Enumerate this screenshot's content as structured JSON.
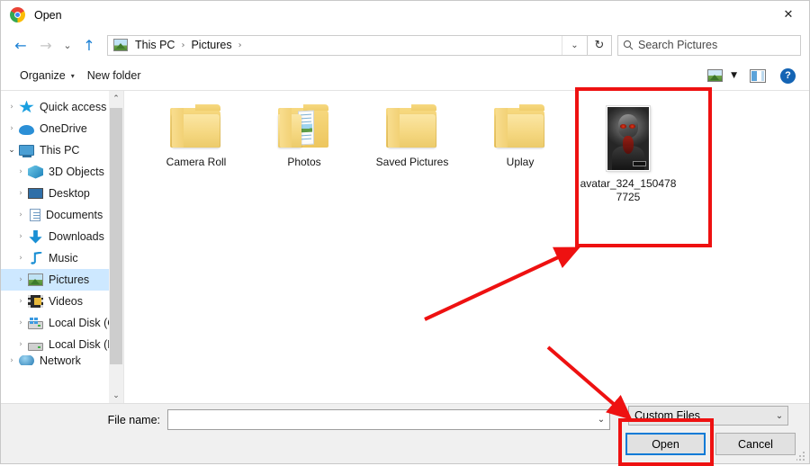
{
  "window": {
    "title": "Open",
    "app_icon": "chrome-logo-icon",
    "close_label": "✕"
  },
  "navbar": {
    "back_icon": "←",
    "forward_icon": "→",
    "recent_icon": "⌄",
    "up_icon": "↑",
    "breadcrumb": {
      "icon": "pictures-folder-icon",
      "items": [
        "This PC",
        "Pictures"
      ],
      "separator": "›",
      "trailing_separator": "›",
      "dropdown_icon": "⌄"
    },
    "refresh_icon": "↻",
    "search": {
      "icon": "🔎",
      "placeholder": "Search Pictures",
      "value": ""
    }
  },
  "toolbar": {
    "organize_label": "Organize",
    "organize_caret": "▾",
    "new_folder_label": "New folder",
    "view_icon": "view-thumbnails-icon",
    "view_caret": "▼",
    "preview_pane_icon": "preview-pane-icon",
    "help_label": "?"
  },
  "sidebar": {
    "items": [
      {
        "label": "Quick access",
        "icon": "star-icon",
        "arrow": "›",
        "level": 0,
        "selected": false,
        "expanded": false
      },
      {
        "label": "OneDrive",
        "icon": "cloud-icon",
        "arrow": "›",
        "level": 0,
        "selected": false,
        "expanded": false
      },
      {
        "label": "This PC",
        "icon": "computer-icon",
        "arrow": "⌄",
        "level": 0,
        "selected": false,
        "expanded": true
      },
      {
        "label": "3D Objects",
        "icon": "3d-objects-icon",
        "arrow": "›",
        "level": 1,
        "selected": false,
        "expanded": false
      },
      {
        "label": "Desktop",
        "icon": "desktop-icon",
        "arrow": "›",
        "level": 1,
        "selected": false,
        "expanded": false
      },
      {
        "label": "Documents",
        "icon": "documents-icon",
        "arrow": "›",
        "level": 1,
        "selected": false,
        "expanded": false
      },
      {
        "label": "Downloads",
        "icon": "downloads-icon",
        "arrow": "›",
        "level": 1,
        "selected": false,
        "expanded": false
      },
      {
        "label": "Music",
        "icon": "music-icon",
        "arrow": "›",
        "level": 1,
        "selected": false,
        "expanded": false
      },
      {
        "label": "Pictures",
        "icon": "pictures-icon",
        "arrow": "›",
        "level": 1,
        "selected": true,
        "expanded": false
      },
      {
        "label": "Videos",
        "icon": "videos-icon",
        "arrow": "›",
        "level": 1,
        "selected": false,
        "expanded": false
      },
      {
        "label": "Local Disk (C:)",
        "icon": "disk-c-icon",
        "arrow": "›",
        "level": 1,
        "selected": false,
        "expanded": false
      },
      {
        "label": "Local Disk (D:)",
        "icon": "disk-d-icon",
        "arrow": "›",
        "level": 1,
        "selected": false,
        "expanded": false
      },
      {
        "label": "Network",
        "icon": "network-icon",
        "arrow": "›",
        "level": 0,
        "selected": false,
        "expanded": false
      }
    ],
    "scroll_up_icon": "⌃",
    "scroll_down_icon": "⌄"
  },
  "files": [
    {
      "name": "Camera Roll",
      "type": "folder"
    },
    {
      "name": "Photos",
      "type": "folder-with-pictures"
    },
    {
      "name": "Saved Pictures",
      "type": "folder"
    },
    {
      "name": "Uplay",
      "type": "folder"
    },
    {
      "name": "avatar_324_1504787725",
      "type": "image",
      "thumbnail": "dark-zombie-avatar-thumbnail",
      "highlighted": true
    }
  ],
  "bottom": {
    "filename_label": "File name:",
    "filename_value": "",
    "filename_caret": "⌄",
    "filter_value": "Custom Files",
    "filter_caret": "⌄",
    "open_label": "Open",
    "cancel_label": "Cancel"
  },
  "annotations": {
    "highlight_color": "#ee1111",
    "file_rect_target": "avatar_324_1504787725",
    "open_rect_target": "Open",
    "arrow_count": 2
  }
}
